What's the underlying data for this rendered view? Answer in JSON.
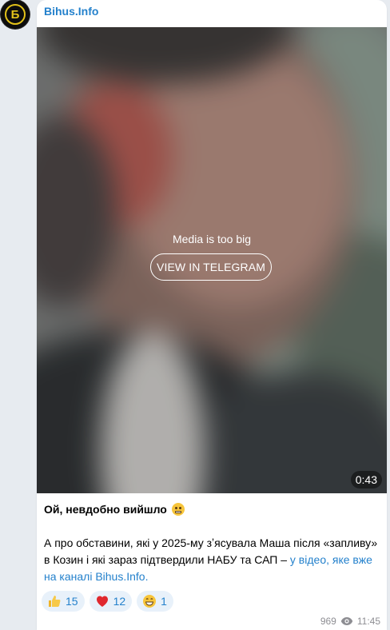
{
  "channel": {
    "name": "Bihus.Info",
    "avatar_letter": "Б",
    "avatar_color": "#e3c21a"
  },
  "media": {
    "notice": "Media is too big",
    "button_label": "VIEW IN TELEGRAM",
    "duration": "0:43"
  },
  "message": {
    "title": "Ой, невдобно вийшло",
    "title_emoji": "grimacing-face-icon",
    "body": "А про обставини, які у 2025-му зʼясувала Маша після «запливу» в Козин і які зараз підтвердили НАБУ та САП – ",
    "link_text": "у відео, яке вже на каналі Bihus.Info."
  },
  "reactions": [
    {
      "icon": "thumbs-up-icon",
      "count": "15"
    },
    {
      "icon": "red-heart-icon",
      "count": "12"
    },
    {
      "icon": "grinning-face-icon",
      "count": "1"
    }
  ],
  "meta": {
    "views": "969",
    "time": "11:45"
  },
  "colors": {
    "link": "#2481cc",
    "page_bg": "#e7ebf0",
    "bubble_bg": "#ffffff",
    "reaction_bg": "#e8f1fa"
  }
}
